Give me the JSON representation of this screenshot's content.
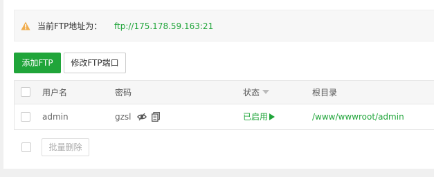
{
  "notice": {
    "label": "当前FTP地址为：",
    "url": "ftp://175.178.59.163:21",
    "icon": "warning-icon"
  },
  "toolbar": {
    "add_label": "添加FTP",
    "port_label": "修改FTP端口"
  },
  "table": {
    "headers": {
      "username": "用户名",
      "password": "密码",
      "status": "状态",
      "root": "根目录"
    },
    "rows": [
      {
        "username": "admin",
        "password": "gzsl",
        "status": "已启用",
        "root": "/www/wwwroot/admin"
      }
    ]
  },
  "footer": {
    "batch_delete_label": "批量删除"
  },
  "colors": {
    "accent": "#20a53a",
    "warning": "#f0ad4e"
  }
}
